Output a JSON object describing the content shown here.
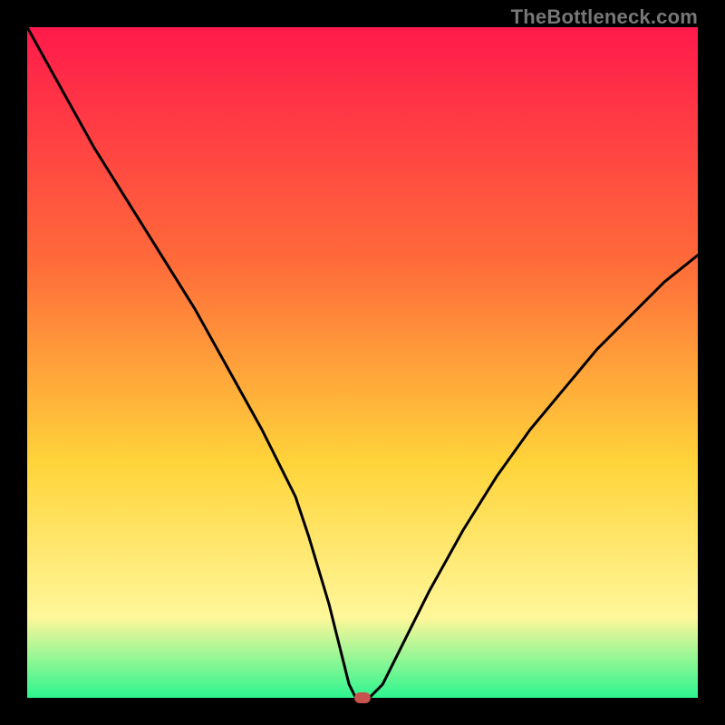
{
  "watermark": "TheBottleneck.com",
  "marker_color": "#c6534d",
  "chart_data": {
    "type": "line",
    "title": "",
    "xlabel": "",
    "ylabel": "",
    "xlim": [
      0,
      100
    ],
    "ylim": [
      0,
      100
    ],
    "background_gradient": [
      "#ff1a4b",
      "#ff6b3a",
      "#ffd43a",
      "#fff79a",
      "#2cf58f"
    ],
    "series": [
      {
        "name": "curve",
        "x": [
          0,
          5,
          10,
          15,
          20,
          25,
          30,
          35,
          40,
          42,
          45,
          48,
          49,
          51,
          53,
          55,
          60,
          65,
          70,
          75,
          80,
          85,
          90,
          95,
          100
        ],
        "values": [
          100,
          91,
          82,
          74,
          66,
          58,
          49,
          40,
          30,
          24,
          14,
          2,
          0,
          0,
          2,
          6,
          16,
          25,
          33,
          40,
          46,
          52,
          57,
          62,
          66
        ]
      }
    ],
    "marker": {
      "x": 50,
      "y": 0
    }
  }
}
